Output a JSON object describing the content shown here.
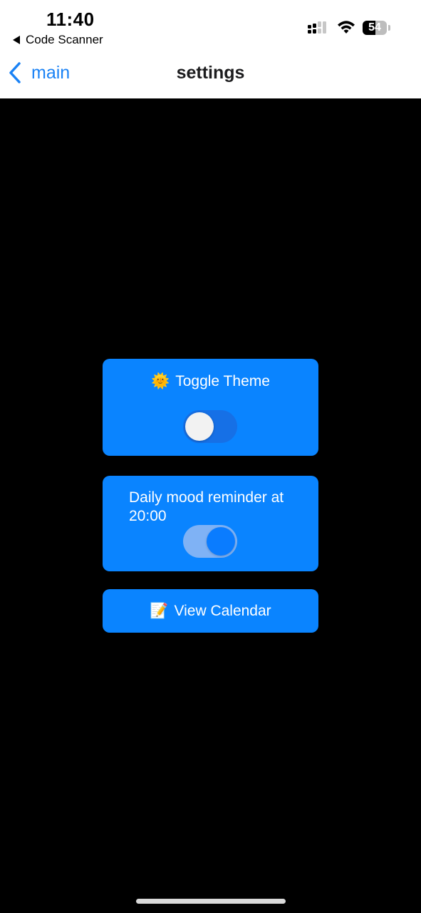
{
  "status_bar": {
    "time": "11:40",
    "back_app_label": "Code Scanner",
    "battery_percent": "54",
    "battery_level": 0.54
  },
  "nav": {
    "back_label": "main",
    "title": "settings"
  },
  "settings": {
    "theme": {
      "emoji": "🌞",
      "label": "Toggle Theme",
      "enabled": false
    },
    "reminder": {
      "label": "Daily mood reminder at 20:00",
      "enabled": true
    },
    "calendar": {
      "emoji": "📝",
      "label": "View Calendar"
    }
  },
  "colors": {
    "accent": "#0a84ff",
    "nav_link": "#1a82f5",
    "background": "#000000",
    "header": "#ffffff"
  }
}
